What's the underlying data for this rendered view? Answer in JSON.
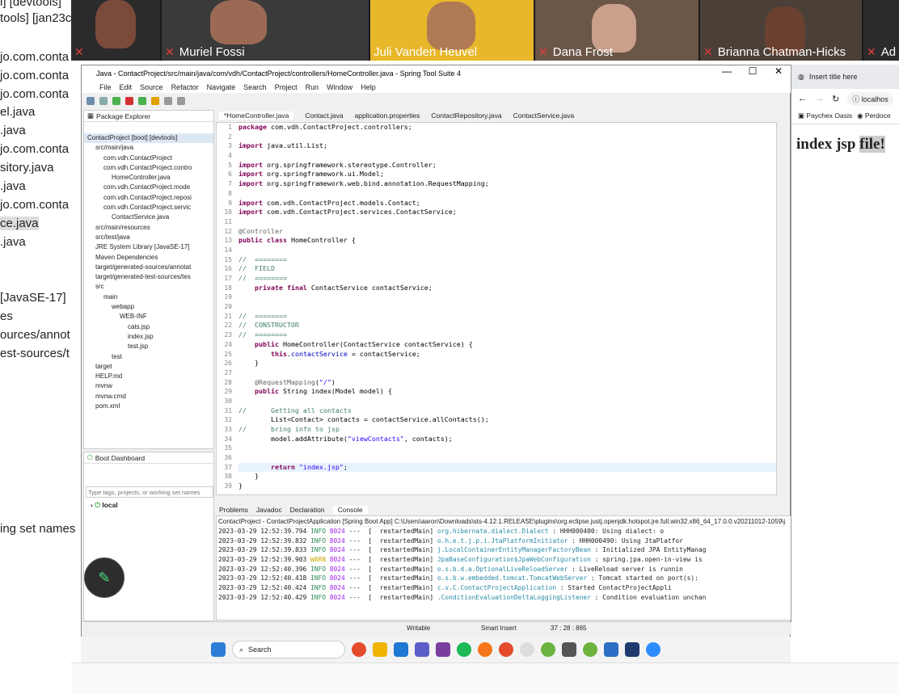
{
  "background_window": {
    "lines": [
      "l] [devtools]",
      "tools] [jan23c",
      "jo.com.conta",
      "jo.com.conta",
      "jo.com.conta",
      "el.java",
      ".java",
      "jo.com.conta",
      "sitory.java",
      ".java",
      "jo.com.conta",
      "ce.java",
      ".java",
      "[JavaSE-17]",
      "es",
      "ources/annot",
      "est-sources/t",
      "ing set names"
    ]
  },
  "participants": [
    "Muriel Fossi",
    "Juli Vanden Heuvel",
    "Dana Frost",
    "Brianna Chatman-Hicks",
    "Ad"
  ],
  "ide": {
    "title": "Java - ContactProject/src/main/java/com/vdh/ContactProject/controllers/HomeController.java - Spring Tool Suite 4",
    "menu": [
      "File",
      "Edit",
      "Source",
      "Refactor",
      "Navigate",
      "Search",
      "Project",
      "Run",
      "Window",
      "Help"
    ],
    "package_explorer_title": "Package Explorer",
    "tree": [
      "ContactProject [boot] [devtools]",
      "src/main/java",
      "com.vdh.ContactProject",
      "com.vdh.ContactProject.contro",
      "HomeController.java",
      "com.vdh.ContactProject.mode",
      "com.vdh.ContactProject.reposi",
      "com.vdh.ContactProject.servic",
      "ContactService.java",
      "src/main/resources",
      "src/test/java",
      "JRE System Library [JavaSE-17]",
      "Maven Dependencies",
      "target/generated-sources/annotat",
      "target/generated-test-sources/tes",
      "src",
      "main",
      "webapp",
      "WEB-INF",
      "cats.jsp",
      "index.jsp",
      "test.jsp",
      "test",
      "target",
      "HELP.md",
      "mvnw",
      "mvnw.cmd",
      "pom.xml"
    ],
    "boot_dashboard_title": "Boot Dashboard",
    "boot_filter_placeholder": "Type tags, projects, or working set names",
    "boot_local": "local",
    "editor_tabs": [
      "*HomeController.java",
      "Contact.java",
      "application.properties",
      "ContactRepository.java",
      "ContactService.java"
    ],
    "code_lines": [
      "package com.vdh.ContactProject.controllers;",
      "",
      "import java.util.List;",
      "",
      "import org.springframework.stereotype.Controller;",
      "import org.springframework.ui.Model;",
      "import org.springframework.web.bind.annotation.RequestMapping;",
      "",
      "import com.vdh.ContactProject.models.Contact;",
      "import com.vdh.ContactProject.services.ContactService;",
      "",
      "@Controller",
      "public class HomeController {",
      "",
      "//  ========",
      "//  FIELD",
      "//  ========",
      "    private final ContactService contactService;",
      "",
      "",
      "//  ========",
      "//  CONSTRUCTOR",
      "//  ========",
      "    public HomeController(ContactService contactService) {",
      "        this.contactService = contactService;",
      "    }",
      "",
      "    @RequestMapping(\"/\")",
      "    public String index(Model model) {",
      "",
      "//      Getting all contacts",
      "        List<Contact> contacts = contactService.allContacts();",
      "//      bring info to jsp",
      "        model.addAttribute(\"viewContacts\", contacts);",
      "",
      "",
      "        return \"index.jsp\";",
      "    }",
      "}"
    ],
    "console_tabs": [
      "Problems",
      "Javadoc",
      "Declaration",
      "Console"
    ],
    "console_header": "ContactProject - ContactProjectApplication [Spring Boot App] C:\\Users\\aaron\\Downloads\\sts-4.12.1.RELEASE\\plugins\\org.eclipse.justj.openjdk.hotspot.jre.full.win32.x86_64_17.0.0.v20211012-1059\\j",
    "log_lines": [
      {
        "ts": "2023-03-29 12:52:39.794",
        "lvl": "INFO",
        "pid": "8024",
        "th": "---  [  restartedMain]",
        "cls": "org.hibernate.dialect.Dialect",
        "msg": ": HHH000400: Using dialect: o"
      },
      {
        "ts": "2023-03-29 12:52:39.832",
        "lvl": "INFO",
        "pid": "8024",
        "th": "---  [  restartedMain]",
        "cls": "o.h.e.t.j.p.i.JtaPlatformInitiator",
        "msg": ": HHH000490: Using JtaPlatfor"
      },
      {
        "ts": "2023-03-29 12:52:39.833",
        "lvl": "INFO",
        "pid": "8024",
        "th": "---  [  restartedMain]",
        "cls": "j.LocalContainerEntityManagerFactoryBean",
        "msg": ": Initialized JPA EntityManag"
      },
      {
        "ts": "2023-03-29 12:52:39.903",
        "lvl": "WARN",
        "pid": "8024",
        "th": "---  [  restartedMain]",
        "cls": "JpaBaseConfiguration$JpaWebConfiguration",
        "msg": ": spring.jpa.open-in-view is"
      },
      {
        "ts": "2023-03-29 12:52:40.396",
        "lvl": "INFO",
        "pid": "8024",
        "th": "---  [  restartedMain]",
        "cls": "o.s.b.d.a.OptionalLiveReloadServer",
        "msg": ": LiveReload server is runnin"
      },
      {
        "ts": "2023-03-29 12:52:40.418",
        "lvl": "INFO",
        "pid": "8024",
        "th": "---  [  restartedMain]",
        "cls": "o.s.b.w.embedded.tomcat.TomcatWebServer",
        "msg": ": Tomcat started on port(s):"
      },
      {
        "ts": "2023-03-29 12:52:40.424",
        "lvl": "INFO",
        "pid": "8024",
        "th": "---  [  restartedMain]",
        "cls": "c.v.C.ContactProjectApplication",
        "msg": ": Started ContactProjectAppli"
      },
      {
        "ts": "2023-03-29 12:52:40.429",
        "lvl": "INFO",
        "pid": "8024",
        "th": "---  [  restartedMain]",
        "cls": ".ConditionEvaluationDeltaLoggingListener",
        "msg": ": Condition evaluation unchan"
      }
    ],
    "status_writable": "Writable",
    "status_insert": "Smart Insert",
    "status_pos": "37 : 28 : 865"
  },
  "taskbar": {
    "search": "Search"
  },
  "browser": {
    "tab_title": "Insert title here",
    "url": "localhos",
    "bookmarks": [
      "Paychex Oasis",
      "Perdoce"
    ],
    "content_plain": "index jsp ",
    "content_selected": "file!"
  },
  "colors": {
    "keyword": "#7f0055",
    "comment": "#3f7f5f",
    "string": "#2a00ff",
    "field": "#0000c0",
    "annotation": "#646464",
    "warn": "#c7a800",
    "info": "#2e8b57"
  }
}
